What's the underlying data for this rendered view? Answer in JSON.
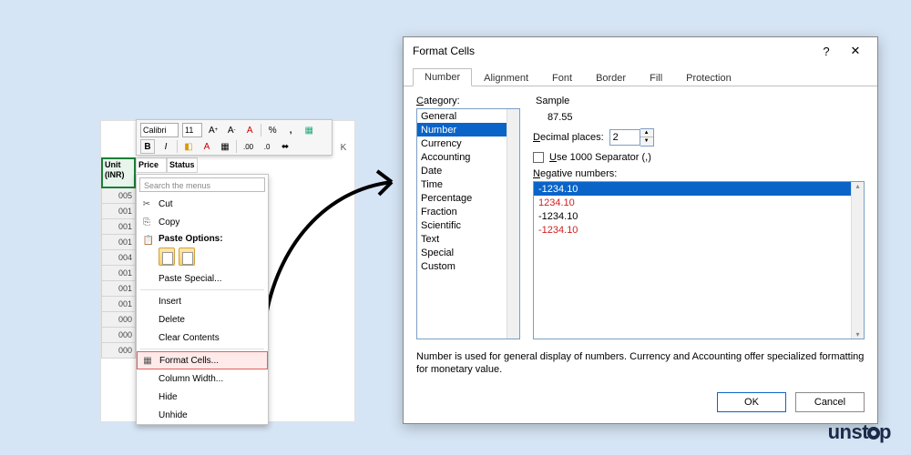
{
  "mini_toolbar": {
    "font_name": "Calibri",
    "font_size": "11",
    "buttons": [
      "A+",
      "A-",
      "A",
      "%",
      ",",
      "table",
      "B",
      "I",
      "fill",
      "font-color",
      "border",
      "decimals",
      "merge"
    ]
  },
  "sheet": {
    "col_k": "K",
    "header_a": "Unit (INR)",
    "header_b": "Price",
    "header_c": "Status",
    "row_labels": [
      "005",
      "001",
      "001",
      "001",
      "004",
      "001",
      "001",
      "001",
      "000",
      "000",
      "000"
    ]
  },
  "context_menu": {
    "search_placeholder": "Search the menus",
    "cut": "Cut",
    "copy": "Copy",
    "paste_options": "Paste Options:",
    "paste_special": "Paste Special...",
    "insert": "Insert",
    "delete": "Delete",
    "clear_contents": "Clear Contents",
    "format_cells": "Format Cells...",
    "column_width": "Column Width...",
    "hide": "Hide",
    "unhide": "Unhide"
  },
  "dialog": {
    "title": "Format Cells",
    "tabs": [
      "Number",
      "Alignment",
      "Font",
      "Border",
      "Fill",
      "Protection"
    ],
    "active_tab": 0,
    "category_label": "Category:",
    "categories": [
      "General",
      "Number",
      "Currency",
      "Accounting",
      "Date",
      "Time",
      "Percentage",
      "Fraction",
      "Scientific",
      "Text",
      "Special",
      "Custom"
    ],
    "category_selected": 1,
    "sample_label": "Sample",
    "sample_value": "87.55",
    "decimal_label": "Decimal places:",
    "decimal_value": "2",
    "thousand_sep": "Use 1000 Separator (,)",
    "negative_label": "Negative numbers:",
    "negative_options": [
      {
        "text": "-1234.10",
        "red": false,
        "selected": true
      },
      {
        "text": "1234.10",
        "red": true,
        "selected": false
      },
      {
        "text": "-1234.10",
        "red": false,
        "selected": false
      },
      {
        "text": "-1234.10",
        "red": true,
        "selected": false
      }
    ],
    "description": "Number is used for general display of numbers.  Currency and Accounting offer specialized formatting for monetary value.",
    "ok": "OK",
    "cancel": "Cancel"
  },
  "logo": {
    "pre": "unst",
    "post": "p"
  }
}
